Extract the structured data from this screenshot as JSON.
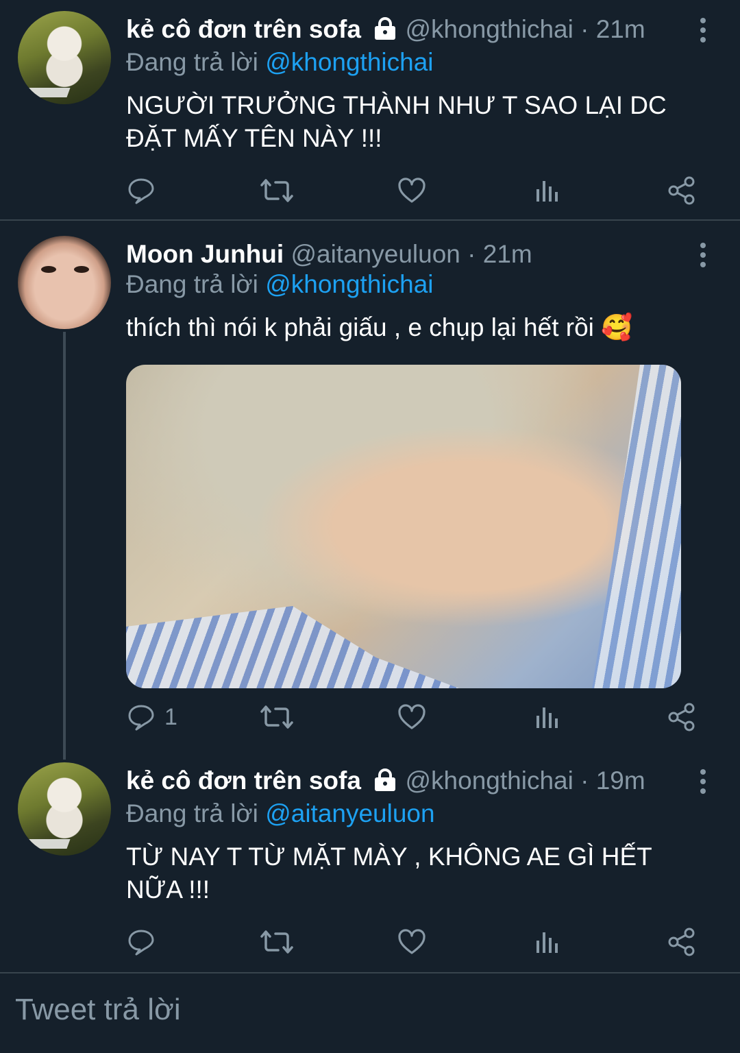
{
  "tweets": [
    {
      "name": "kẻ cô đơn trên sofa",
      "locked": true,
      "handle": "@khongthichai",
      "separator": "·",
      "time": "21m",
      "replying_prefix": "Đang trả lời",
      "replying_to": "@khongthichai",
      "text_lines": [
        "NGƯỜI TRƯỞNG THÀNH NHƯ T SAO LẠI DC",
        "ĐẶT MẤY TÊN NÀY !!!"
      ],
      "reply_count": ""
    },
    {
      "name": "Moon Junhui",
      "locked": false,
      "handle": "@aitanyeuluon",
      "separator": "·",
      "time": "21m",
      "replying_prefix": "Đang trả lời",
      "replying_to": "@khongthichai",
      "text_lines": [
        "thích thì nói k phải giấu , e chụp lại hết rồi 🥰"
      ],
      "has_media": true,
      "reply_count": "1"
    },
    {
      "name": "kẻ cô đơn trên sofa",
      "locked": true,
      "handle": "@khongthichai",
      "separator": "·",
      "time": "19m",
      "replying_prefix": "Đang trả lời",
      "replying_to": "@aitanyeuluon",
      "text_lines": [
        "TỪ NAY T TỪ MẶT MÀY , KHÔNG AE GÌ HẾT",
        "NỮA !!!"
      ],
      "reply_count": ""
    }
  ],
  "icons": {
    "reply": "reply-icon",
    "retweet": "retweet-icon",
    "like": "heart-icon",
    "analytics": "analytics-icon",
    "share": "share-icon",
    "more": "more-vertical-icon",
    "lock": "lock-icon"
  },
  "reply_box": {
    "placeholder": "Tweet trả lời"
  },
  "colors": {
    "background": "#15202b",
    "secondary_text": "#8899a6",
    "link": "#1da1f2",
    "divider": "#38444d"
  }
}
